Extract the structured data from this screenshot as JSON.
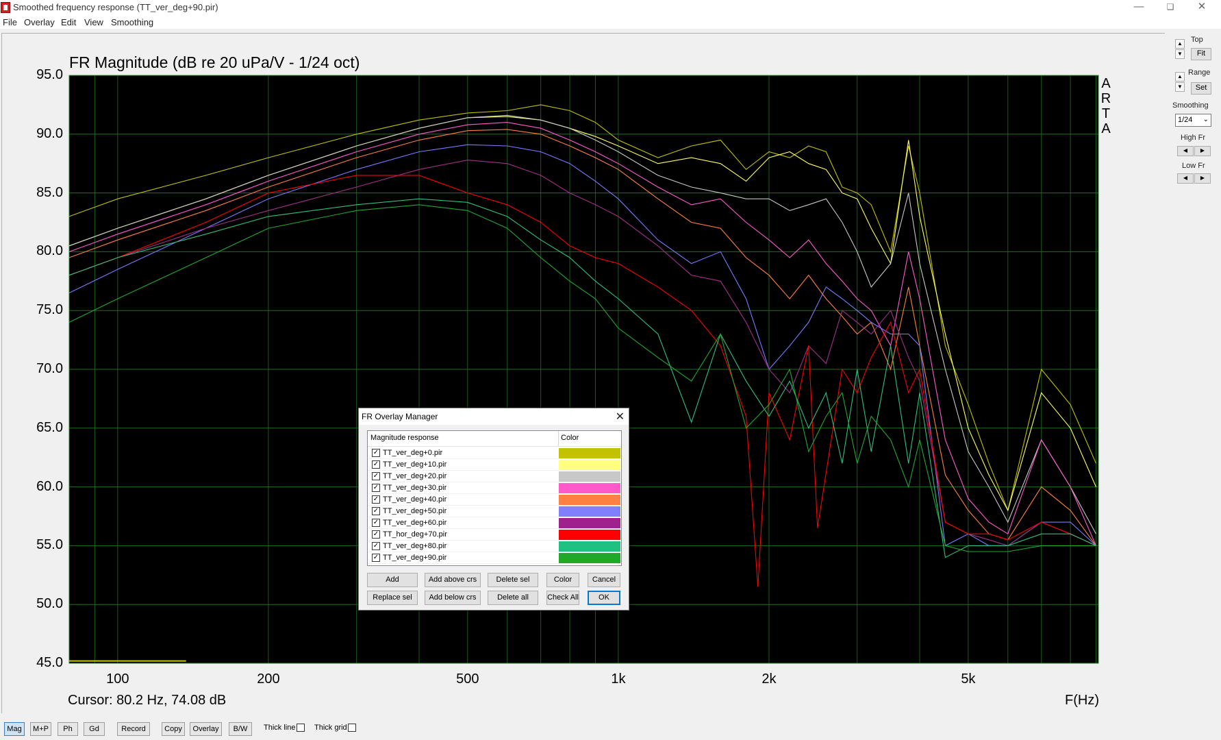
{
  "window": {
    "title": "Smoothed frequency response (TT_ver_deg+90.pir)"
  },
  "menu": [
    "File",
    "Overlay",
    "Edit",
    "View",
    "Smoothing"
  ],
  "chart_data": {
    "type": "line",
    "title": "FR Magnitude (dB re 20 uPa/V - 1/24 oct)",
    "xlabel": "F(Hz)",
    "ylabel": "",
    "xscale": "log",
    "xlim": [
      80,
      9100
    ],
    "ylim": [
      45,
      95
    ],
    "yticks": [
      "95.0",
      "90.0",
      "85.0",
      "80.0",
      "75.0",
      "70.0",
      "65.0",
      "60.0",
      "55.0",
      "50.0",
      "45.0"
    ],
    "xticks": [
      {
        "label": "100",
        "value": 100
      },
      {
        "label": "200",
        "value": 200
      },
      {
        "label": "500",
        "value": 500
      },
      {
        "label": "1k",
        "value": 1000
      },
      {
        "label": "2k",
        "value": 2000
      },
      {
        "label": "5k",
        "value": 5000
      }
    ],
    "grid": true,
    "background": "#000000",
    "gridcolor": "#1f6e1f",
    "series": [
      {
        "name": "TT_ver_deg+0.pir",
        "color": "#c2c200",
        "x": [
          80,
          100,
          150,
          200,
          300,
          400,
          500,
          600,
          700,
          800,
          900,
          1000,
          1200,
          1400,
          1600,
          1800,
          2000,
          2200,
          2400,
          2600,
          2800,
          3000,
          3200,
          3500,
          3800,
          4000,
          4500,
          5000,
          5500,
          6000,
          7000,
          8000,
          9000
        ],
        "y": [
          83,
          84.5,
          86.5,
          88,
          90,
          91.2,
          91.8,
          92,
          92.5,
          92,
          91,
          89.5,
          88,
          89,
          89.5,
          87,
          88.5,
          88,
          89,
          88.5,
          85.5,
          85,
          84,
          80,
          89,
          85,
          72,
          67,
          62,
          58,
          70,
          67,
          62
        ]
      },
      {
        "name": "TT_ver_deg+10.pir",
        "color": "#ffff66",
        "x": [
          80,
          100,
          150,
          200,
          300,
          400,
          500,
          600,
          700,
          800,
          900,
          1000,
          1200,
          1400,
          1600,
          1800,
          2000,
          2200,
          2400,
          2600,
          2800,
          3000,
          3200,
          3500,
          3800,
          4000,
          4500,
          5000,
          5500,
          6000,
          7000,
          8000,
          9000
        ],
        "y": [
          80.5,
          82,
          84.5,
          86.5,
          89,
          90.5,
          91.4,
          91.5,
          91.2,
          90.5,
          89.8,
          89,
          87.5,
          88,
          87.5,
          86,
          88,
          88.5,
          87.5,
          87,
          85,
          84.5,
          82,
          79,
          89.5,
          83,
          73,
          65,
          61,
          58,
          68,
          65,
          60
        ]
      },
      {
        "name": "TT_ver_deg+20.pir",
        "color": "#c8c8c8",
        "x": [
          80,
          100,
          150,
          200,
          300,
          400,
          500,
          600,
          700,
          800,
          900,
          1000,
          1200,
          1400,
          1600,
          1800,
          2000,
          2200,
          2400,
          2600,
          2800,
          3000,
          3200,
          3500,
          3800,
          4000,
          4500,
          5000,
          5500,
          6000,
          7000,
          8000,
          9000
        ],
        "y": [
          80.5,
          82,
          84.5,
          86.5,
          89,
          90.5,
          91.4,
          91.6,
          91.2,
          90.5,
          89.5,
          88.5,
          86.5,
          85.5,
          85,
          84.5,
          84.5,
          83.5,
          84,
          84.5,
          82.5,
          80,
          77,
          79,
          85,
          79,
          70,
          63,
          60,
          57,
          64,
          60,
          56
        ]
      },
      {
        "name": "TT_ver_deg+30.pir",
        "color": "#ff5ad2",
        "x": [
          80,
          100,
          150,
          200,
          300,
          400,
          500,
          600,
          700,
          800,
          900,
          1000,
          1200,
          1400,
          1600,
          1800,
          2000,
          2200,
          2400,
          2600,
          2800,
          3000,
          3200,
          3500,
          3800,
          4000,
          4500,
          5000,
          5500,
          6000,
          7000,
          8000,
          9000
        ],
        "y": [
          80,
          81.5,
          84,
          86,
          88.5,
          90,
          90.8,
          91,
          90.5,
          89.5,
          88.5,
          87.5,
          85.5,
          84,
          84.5,
          82.5,
          81,
          79.5,
          81,
          79,
          77.5,
          76,
          75,
          72,
          80,
          76,
          64,
          59,
          57,
          56,
          64,
          60,
          55
        ]
      },
      {
        "name": "TT_ver_deg+40.pir",
        "color": "#ff8040",
        "x": [
          80,
          100,
          150,
          200,
          300,
          400,
          500,
          600,
          700,
          800,
          900,
          1000,
          1200,
          1400,
          1600,
          1800,
          2000,
          2200,
          2400,
          2600,
          2800,
          3000,
          3200,
          3500,
          3800,
          4000,
          4500,
          5000,
          5500,
          6000,
          7000,
          8000,
          9000
        ],
        "y": [
          79.5,
          81,
          83.5,
          85.5,
          88,
          89.5,
          90.3,
          90.4,
          90,
          89,
          88,
          87,
          84.5,
          82.5,
          82,
          79.5,
          78,
          76,
          78,
          76,
          74.5,
          73,
          74,
          70,
          77,
          72,
          61,
          58,
          56,
          55.5,
          60,
          58,
          55
        ]
      },
      {
        "name": "TT_ver_deg+50.pir",
        "color": "#7a7aff",
        "x": [
          80,
          100,
          150,
          200,
          300,
          400,
          500,
          600,
          700,
          800,
          900,
          1000,
          1200,
          1400,
          1600,
          1800,
          2000,
          2200,
          2400,
          2600,
          2800,
          3000,
          3200,
          3500,
          3800,
          4000,
          4500,
          5000,
          5500,
          6000,
          7000,
          8000,
          9000
        ],
        "y": [
          76.5,
          78.5,
          82,
          84.5,
          87,
          88.5,
          89.1,
          89,
          88.5,
          87.5,
          86,
          84.5,
          81,
          79,
          80,
          76,
          70,
          72,
          74,
          77,
          76,
          75,
          74,
          73,
          73,
          72,
          55,
          56,
          55,
          55,
          57,
          57,
          55
        ]
      },
      {
        "name": "TT_ver_deg+60.pir",
        "color": "#a0308a",
        "x": [
          80,
          100,
          150,
          200,
          300,
          400,
          500,
          600,
          700,
          800,
          900,
          1000,
          1200,
          1400,
          1600,
          1800,
          2000,
          2200,
          2400,
          2600,
          2800,
          3000,
          3200,
          3500,
          3800,
          4000,
          4500,
          5000,
          5500,
          6000,
          7000,
          8000,
          9000
        ],
        "y": [
          78,
          79.5,
          82,
          83.5,
          85.5,
          87,
          87.8,
          87.5,
          86.5,
          85,
          84,
          83,
          80.5,
          78,
          77.5,
          74,
          70,
          68,
          72,
          70.5,
          75,
          74,
          73,
          75,
          71,
          69,
          57,
          56,
          55.5,
          55,
          57,
          56,
          55
        ]
      },
      {
        "name": "TT_hor_deg+70.pir",
        "color": "#ff0000",
        "x": [
          80,
          100,
          150,
          200,
          300,
          400,
          500,
          600,
          700,
          800,
          900,
          1000,
          1200,
          1400,
          1600,
          1800,
          1900,
          2000,
          2200,
          2400,
          2500,
          2800,
          3000,
          3200,
          3500,
          3800,
          4000,
          4500,
          5000,
          5500,
          6000,
          7000,
          8000,
          9000
        ],
        "y": [
          78,
          79.5,
          82.5,
          85,
          86.5,
          86.5,
          85,
          84,
          82.5,
          80.5,
          79.5,
          79,
          77,
          75,
          72,
          66,
          51.5,
          68,
          64,
          72,
          56.5,
          70,
          68,
          71,
          74,
          68,
          70,
          57,
          56,
          56,
          55.5,
          57,
          56,
          55
        ]
      },
      {
        "name": "TT_ver_deg+80.pir",
        "color": "#30c080",
        "x": [
          80,
          100,
          150,
          200,
          300,
          400,
          500,
          600,
          700,
          800,
          900,
          1000,
          1200,
          1400,
          1600,
          1800,
          2000,
          2200,
          2400,
          2600,
          2800,
          3000,
          3200,
          3500,
          3800,
          4000,
          4500,
          5000,
          5500,
          6000,
          7000,
          8000,
          9000
        ],
        "y": [
          78,
          79.5,
          81.5,
          83,
          84,
          84.5,
          84.2,
          83,
          81,
          79.5,
          77.5,
          76,
          73,
          65.5,
          73,
          69,
          66,
          69,
          65,
          68,
          62,
          70,
          63,
          72,
          62,
          68,
          54,
          55,
          55,
          55,
          56,
          56,
          55
        ]
      },
      {
        "name": "TT_ver_deg+90.pir",
        "color": "#20a830",
        "x": [
          80,
          100,
          150,
          200,
          300,
          400,
          500,
          600,
          700,
          800,
          900,
          1000,
          1200,
          1400,
          1600,
          1800,
          2000,
          2200,
          2400,
          2600,
          2800,
          3000,
          3200,
          3500,
          3800,
          4000,
          4500,
          5000,
          5500,
          6000,
          7000,
          8000,
          9000
        ],
        "y": [
          74,
          76,
          79.5,
          82,
          83.5,
          84,
          83.5,
          82,
          79.5,
          77.5,
          76,
          73.5,
          71,
          69,
          73,
          65,
          67,
          70,
          63,
          66,
          68,
          62,
          66,
          64,
          60,
          64,
          55,
          54.5,
          54.5,
          54.5,
          55,
          55,
          55
        ]
      }
    ],
    "marker": {
      "x": [
        80,
        137
      ],
      "y": 45.2,
      "color": "#c8c800"
    }
  },
  "cursor_readout": "Cursor: 80.2 Hz, 74.08 dB",
  "arta_logo": [
    "A",
    "R",
    "T",
    "A"
  ],
  "right_panel": {
    "top_label": "Top",
    "fit_label": "Fit",
    "range_label": "Range",
    "set_label": "Set",
    "smoothing_label": "Smoothing",
    "smoothing_value": "1/24",
    "highfr_label": "High Fr",
    "lowfr_label": "Low Fr"
  },
  "toolbar": {
    "buttons": [
      "Mag",
      "M+P",
      "Ph",
      "Gd",
      "Record",
      "Copy",
      "Overlay",
      "B/W"
    ],
    "thick_line": "Thick line",
    "thick_grid": "Thick grid"
  },
  "dialog": {
    "title": "FR Overlay Manager",
    "col_magnitude": "Magnitude response",
    "col_color": "Color",
    "rows": [
      {
        "name": "TT_ver_deg+0.pir",
        "color": "#c2c200",
        "checked": true
      },
      {
        "name": "TT_ver_deg+10.pir",
        "color": "#ffff80",
        "checked": true
      },
      {
        "name": "TT_ver_deg+20.pir",
        "color": "#c8c8c8",
        "checked": true
      },
      {
        "name": "TT_ver_deg+30.pir",
        "color": "#ff5ac8",
        "checked": true
      },
      {
        "name": "TT_ver_deg+40.pir",
        "color": "#ff8040",
        "checked": true
      },
      {
        "name": "TT_ver_deg+50.pir",
        "color": "#8080ff",
        "checked": true
      },
      {
        "name": "TT_ver_deg+60.pir",
        "color": "#a0208c",
        "checked": true
      },
      {
        "name": "TT_hor_deg+70.pir",
        "color": "#ff0000",
        "checked": true
      },
      {
        "name": "TT_ver_deg+80.pir",
        "color": "#20c080",
        "checked": true
      },
      {
        "name": "TT_ver_deg+90.pir",
        "color": "#20a828",
        "checked": true
      }
    ],
    "buttons": {
      "add": "Add",
      "add_above": "Add above crs",
      "delete_sel": "Delete sel",
      "color": "Color",
      "cancel": "Cancel",
      "replace_sel": "Replace sel",
      "add_below": "Add below crs",
      "delete_all": "Delete all",
      "check_all": "Check All",
      "ok": "OK"
    }
  }
}
